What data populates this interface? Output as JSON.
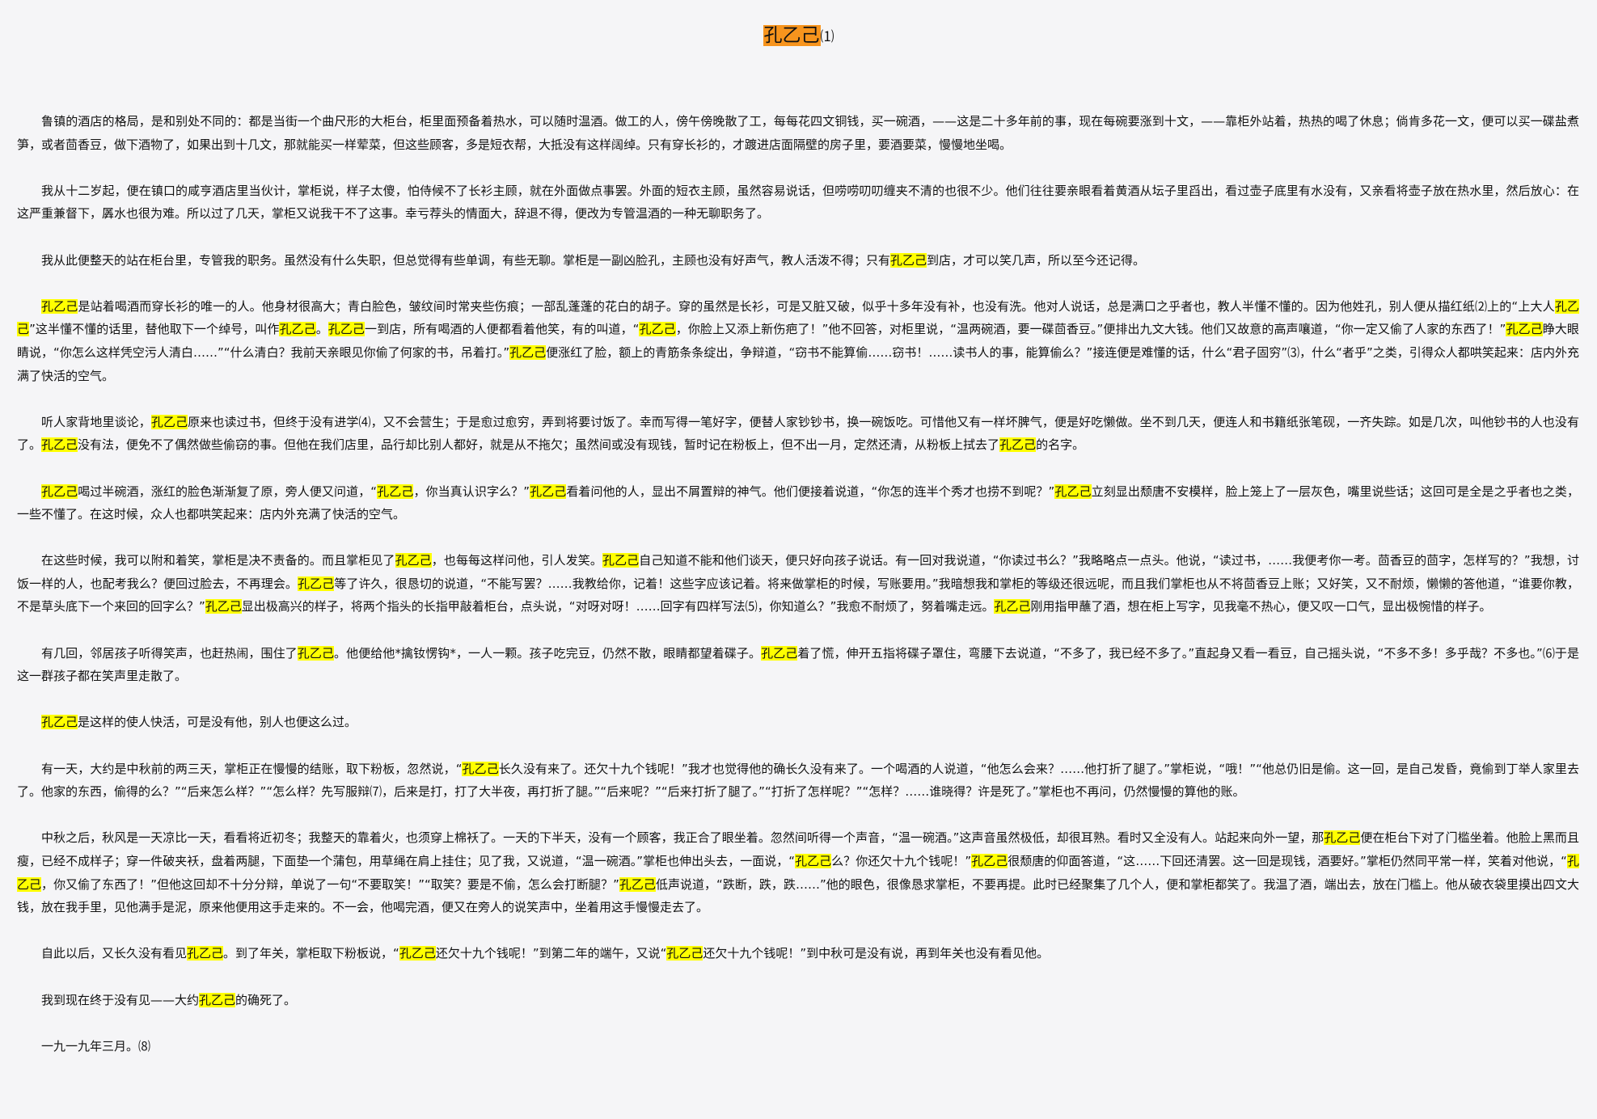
{
  "title": {
    "text": "孔乙己",
    "note": "⑴",
    "highlight_color": "#f7941d"
  },
  "highlight": {
    "term": "孔乙己",
    "color": "#ffff00"
  },
  "paragraphs": [
    "鲁镇的酒店的格局，是和别处不同的：都是当街一个曲尺形的大柜台，柜里面预备着热水，可以随时温酒。做工的人，傍午傍晚散了工，每每花四文铜钱，买一碗酒，——这是二十多年前的事，现在每碗要涨到十文，——靠柜外站着，热热的喝了休息；倘肯多花一文，便可以买一碟盐煮笋，或者茴香豆，做下酒物了，如果出到十几文，那就能买一样荤菜，但这些顾客，多是短衣帮，大抵没有这样阔绰。只有穿长衫的，才踱进店面隔壁的房子里，要酒要菜，慢慢地坐喝。",
    "我从十二岁起，便在镇口的咸亨酒店里当伙计，掌柜说，样子太傻，怕侍候不了长衫主顾，就在外面做点事罢。外面的短衣主顾，虽然容易说话，但唠唠叨叨缠夹不清的也很不少。他们往往要亲眼看着黄酒从坛子里舀出，看过壶子底里有水没有，又亲看将壶子放在热水里，然后放心：在这严重兼督下，羼水也很为难。所以过了几天，掌柜又说我干不了这事。幸亏荐头的情面大，辞退不得，便改为专管温酒的一种无聊职务了。",
    "我从此便整天的站在柜台里，专管我的职务。虽然没有什么失职，但总觉得有些单调，有些无聊。掌柜是一副凶脸孔，主顾也没有好声气，教人活泼不得；只有孔乙己到店，才可以笑几声，所以至今还记得。",
    "孔乙己是站着喝酒而穿长衫的唯一的人。他身材很高大；青白脸色，皱纹间时常夹些伤痕；一部乱蓬蓬的花白的胡子。穿的虽然是长衫，可是又脏又破，似乎十多年没有补，也没有洗。他对人说话，总是满口之乎者也，教人半懂不懂的。因为他姓孔，别人便从描红纸⑵上的“上大人孔乙己”这半懂不懂的话里，替他取下一个绰号，叫作孔乙己。孔乙己一到店，所有喝酒的人便都看着他笑，有的叫道，“孔乙己，你脸上又添上新伤疤了！”他不回答，对柜里说，“温两碗酒，要一碟茴香豆。”便排出九文大钱。他们又故意的高声嚷道，“你一定又偷了人家的东西了！”孔乙己睁大眼睛说，“你怎么这样凭空污人清白……”“什么清白？我前天亲眼见你偷了何家的书，吊着打。”孔乙己便涨红了脸，额上的青筋条条绽出，争辩道，“窃书不能算偷……窃书！……读书人的事，能算偷么？”接连便是难懂的话，什么“君子固穷”⑶，什么“者乎”之类，引得众人都哄笑起来：店内外充满了快活的空气。",
    "听人家背地里谈论，孔乙己原来也读过书，但终于没有进学⑷，又不会营生；于是愈过愈穷，弄到将要讨饭了。幸而写得一笔好字，便替人家钞钞书，换一碗饭吃。可惜他又有一样坏脾气，便是好吃懒做。坐不到几天，便连人和书籍纸张笔砚，一齐失踪。如是几次，叫他钞书的人也没有了。孔乙己没有法，便免不了偶然做些偷窃的事。但他在我们店里，品行却比别人都好，就是从不拖欠；虽然间或没有现钱，暂时记在粉板上，但不出一月，定然还清，从粉板上拭去了孔乙己的名字。",
    "孔乙己喝过半碗酒，涨红的脸色渐渐复了原，旁人便又问道，“孔乙己，你当真认识字么？”孔乙己看着问他的人，显出不屑置辩的神气。他们便接着说道，“你怎的连半个秀才也捞不到呢？”孔乙己立刻显出颓唐不安模样，脸上笼上了一层灰色，嘴里说些话；这回可是全是之乎者也之类，一些不懂了。在这时候，众人也都哄笑起来：店内外充满了快活的空气。",
    "在这些时候，我可以附和着笑，掌柜是决不责备的。而且掌柜见了孔乙己，也每每这样问他，引人发笑。孔乙己自己知道不能和他们谈天，便只好向孩子说话。有一回对我说道，“你读过书么？”我略略点一点头。他说，“读过书，……我便考你一考。茴香豆的茴字，怎样写的？”我想，讨饭一样的人，也配考我么？便回过脸去，不再理会。孔乙己等了许久，很恳切的说道，“不能写罢？……我教给你，记着！这些字应该记着。将来做掌柜的时候，写账要用。”我暗想我和掌柜的等级还很远呢，而且我们掌柜也从不将茴香豆上账；又好笑，又不耐烦，懒懒的答他道，“谁要你教，不是草头底下一个来回的回字么？”孔乙己显出极高兴的样子，将两个指头的长指甲敲着柜台，点头说，“对呀对呀！……回字有四样写法⑸，你知道么？”我愈不耐烦了，努着嘴走远。孔乙己刚用指甲蘸了酒，想在柜上写字，见我毫不热心，便又叹一口气，显出极惋惜的样子。",
    "有几回，邻居孩子听得笑声，也赶热闹，围住了孔乙己。他便给他*擒钕愣钩*，一人一颗。孩子吃完豆，仍然不散，眼睛都望着碟子。孔乙己着了慌，伸开五指将碟子罩住，弯腰下去说道，“不多了，我已经不多了。”直起身又看一看豆，自己摇头说，“不多不多！多乎哉？不多也。”⑹于是这一群孩子都在笑声里走散了。",
    "孔乙己是这样的使人快活，可是没有他，别人也便这么过。",
    "有一天，大约是中秋前的两三天，掌柜正在慢慢的结账，取下粉板，忽然说，“孔乙己长久没有来了。还欠十九个钱呢！”我才也觉得他的确长久没有来了。一个喝酒的人说道，“他怎么会来？……他打折了腿了。”掌柜说，“哦！”“他总仍旧是偷。这一回，是自己发昏，竟偷到丁举人家里去了。他家的东西，偷得的么？”“后来怎么样？”“怎么样？先写服辩⑺，后来是打，打了大半夜，再打折了腿。”“后来呢？”“后来打折了腿了。”“打折了怎样呢？”“怎样？……谁晓得？许是死了。”掌柜也不再问，仍然慢慢的算他的账。",
    "中秋之后，秋风是一天凉比一天，看看将近初冬；我整天的靠着火，也须穿上棉袄了。一天的下半天，没有一个顾客，我正合了眼坐着。忽然间听得一个声音，“温一碗酒。”这声音虽然极低，却很耳熟。看时又全没有人。站起来向外一望，那孔乙己便在柜台下对了门槛坐着。他脸上黑而且瘦，已经不成样子；穿一件破夹袄，盘着两腿，下面垫一个蒲包，用草绳在肩上挂住；见了我，又说道，“温一碗酒。”掌柜也伸出头去，一面说，“孔乙己么？你还欠十九个钱呢！”孔乙己很颓唐的仰面答道，“这……下回还清罢。这一回是现钱，酒要好。”掌柜仍然同平常一样，笑着对他说，“孔乙己，你又偷了东西了！”但他这回却不十分分辩，单说了一句“不要取笑！”“取笑？要是不偷，怎么会打断腿？”孔乙己低声说道，“跌断，跌，跌……”他的眼色，很像恳求掌柜，不要再提。此时已经聚集了几个人，便和掌柜都笑了。我温了酒，端出去，放在门槛上。他从破衣袋里摸出四文大钱，放在我手里，见他满手是泥，原来他便用这手走来的。不一会，他喝完酒，便又在旁人的说笑声中，坐着用这手慢慢走去了。",
    "自此以后，又长久没有看见孔乙己。到了年关，掌柜取下粉板说，“孔乙己还欠十九个钱呢！”到第二年的端午，又说“孔乙己还欠十九个钱呢！”到中秋可是没有说，再到年关也没有看见他。",
    "我到现在终于没有见——大约孔乙己的确死了。",
    "一九一九年三月。⑻"
  ]
}
